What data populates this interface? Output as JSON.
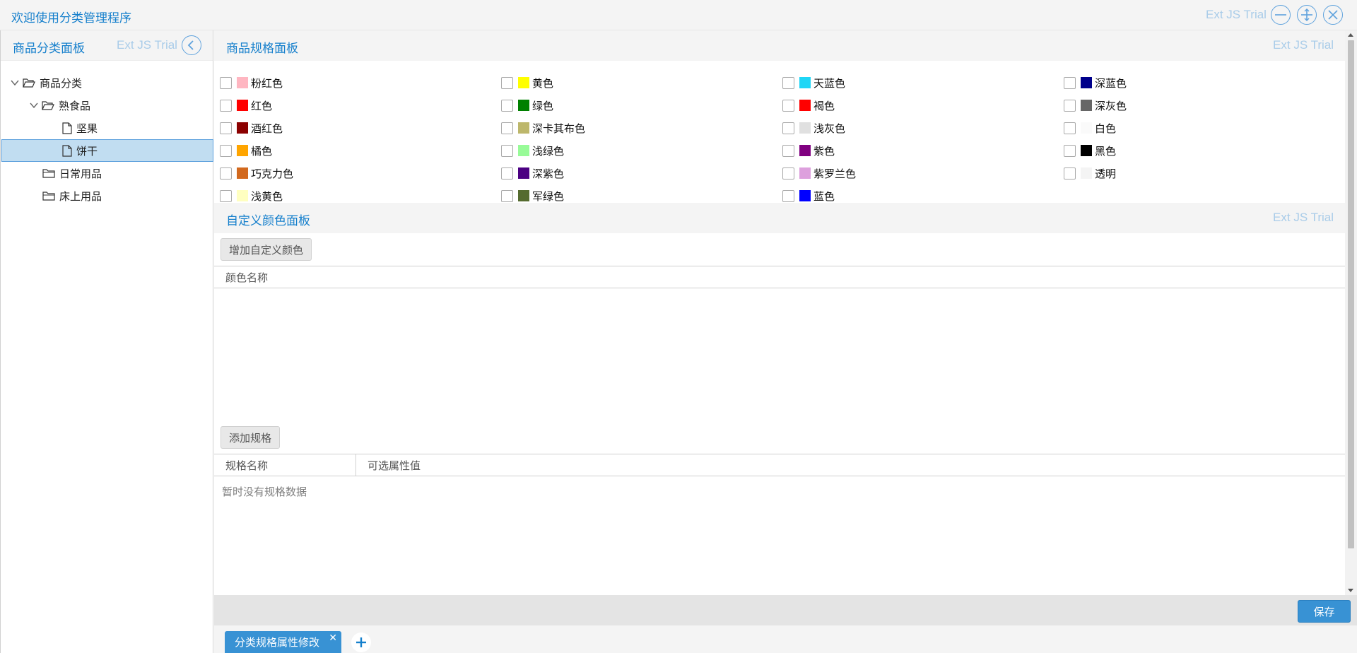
{
  "window": {
    "title": "欢迎使用分类管理程序",
    "trial": "Ext JS Trial"
  },
  "left_panel": {
    "title": "商品分类面板",
    "trial": "Ext JS Trial",
    "tree": [
      {
        "label": "商品分类",
        "type": "folder",
        "expanded": true
      },
      {
        "label": "熟食品",
        "type": "folder",
        "expanded": true
      },
      {
        "label": "坚果",
        "type": "leaf"
      },
      {
        "label": "饼干",
        "type": "leaf",
        "selected": true
      },
      {
        "label": "日常用品",
        "type": "folder"
      },
      {
        "label": "床上用品",
        "type": "folder"
      }
    ]
  },
  "spec_panel": {
    "title": "商品规格面板",
    "trial": "Ext JS Trial",
    "colors": [
      {
        "name": "粉红色",
        "color": "#ffb6c1"
      },
      {
        "name": "红色",
        "color": "#ff0000"
      },
      {
        "name": "酒红色",
        "color": "#8b0000"
      },
      {
        "name": "橘色",
        "color": "#ffa500"
      },
      {
        "name": "巧克力色",
        "color": "#d2691e"
      },
      {
        "name": "浅黄色",
        "color": "#ffffc0"
      },
      {
        "name": "黄色",
        "color": "#ffff00"
      },
      {
        "name": "绿色",
        "color": "#008000"
      },
      {
        "name": "深卡其布色",
        "color": "#bdb76b"
      },
      {
        "name": "浅绿色",
        "color": "#98fb98"
      },
      {
        "name": "深紫色",
        "color": "#4b0082"
      },
      {
        "name": "军绿色",
        "color": "#556b2f"
      },
      {
        "name": "天蓝色",
        "color": "#1fd6f6"
      },
      {
        "name": "褐色",
        "color": "#ff0000"
      },
      {
        "name": "浅灰色",
        "color": "#e0e0e0"
      },
      {
        "name": "紫色",
        "color": "#800080"
      },
      {
        "name": "紫罗兰色",
        "color": "#dda0dd"
      },
      {
        "name": "蓝色",
        "color": "#0000ff"
      },
      {
        "name": "深蓝色",
        "color": "#00008b"
      },
      {
        "name": "深灰色",
        "color": "#666666"
      },
      {
        "name": "白色",
        "color": "#fafafa"
      },
      {
        "name": "黑色",
        "color": "#000000"
      },
      {
        "name": "透明",
        "color": "#f4f4f4"
      }
    ]
  },
  "custom_panel": {
    "title": "自定义颜色面板",
    "trial": "Ext JS Trial",
    "add_button": "增加自定义颜色",
    "column_color_name": "颜色名称",
    "add_spec_button": "添加规格",
    "column_spec_name": "规格名称",
    "column_values": "可选属性值",
    "empty_text": "暂时没有规格数据"
  },
  "footer": {
    "save_label": "保存"
  },
  "tabs": [
    {
      "label": "分类规格属性修改"
    }
  ],
  "accent": "#157fcc"
}
